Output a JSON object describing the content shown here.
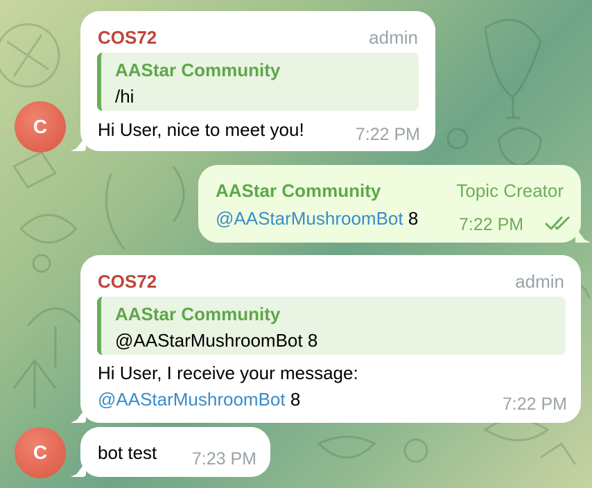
{
  "chat": {
    "messages": [
      {
        "sender": "COS72",
        "role": "admin",
        "reply_to": {
          "title": "AAStar Community",
          "text": "/hi"
        },
        "text": "Hi User, nice to meet you!",
        "time": "7:22 PM"
      },
      {
        "sender": "AAStar Community",
        "role": "Topic Creator",
        "mention": "@AAStarMushroomBot",
        "text_after_mention": " 8",
        "time": "7:22 PM",
        "status": "read"
      },
      {
        "sender": "COS72",
        "role": "admin",
        "reply_to": {
          "title": "AAStar Community",
          "text": "@AAStarMushroomBot 8"
        },
        "text_line1": "Hi User, I receive your message:",
        "mention": "@AAStarMushroomBot",
        "text_after_mention": " 8",
        "time": "7:22 PM"
      },
      {
        "text": "bot test",
        "time": "7:23 PM"
      }
    ],
    "avatars": [
      {
        "initial": "C"
      },
      {
        "initial": "C"
      }
    ]
  },
  "colors": {
    "sender_name": "#c0443a",
    "quote_accent": "#6aae57",
    "mention_link": "#3a8bc9",
    "outgoing_bubble": "#effdde",
    "incoming_bubble": "#ffffff"
  },
  "icons": [
    "double-check-icon"
  ]
}
